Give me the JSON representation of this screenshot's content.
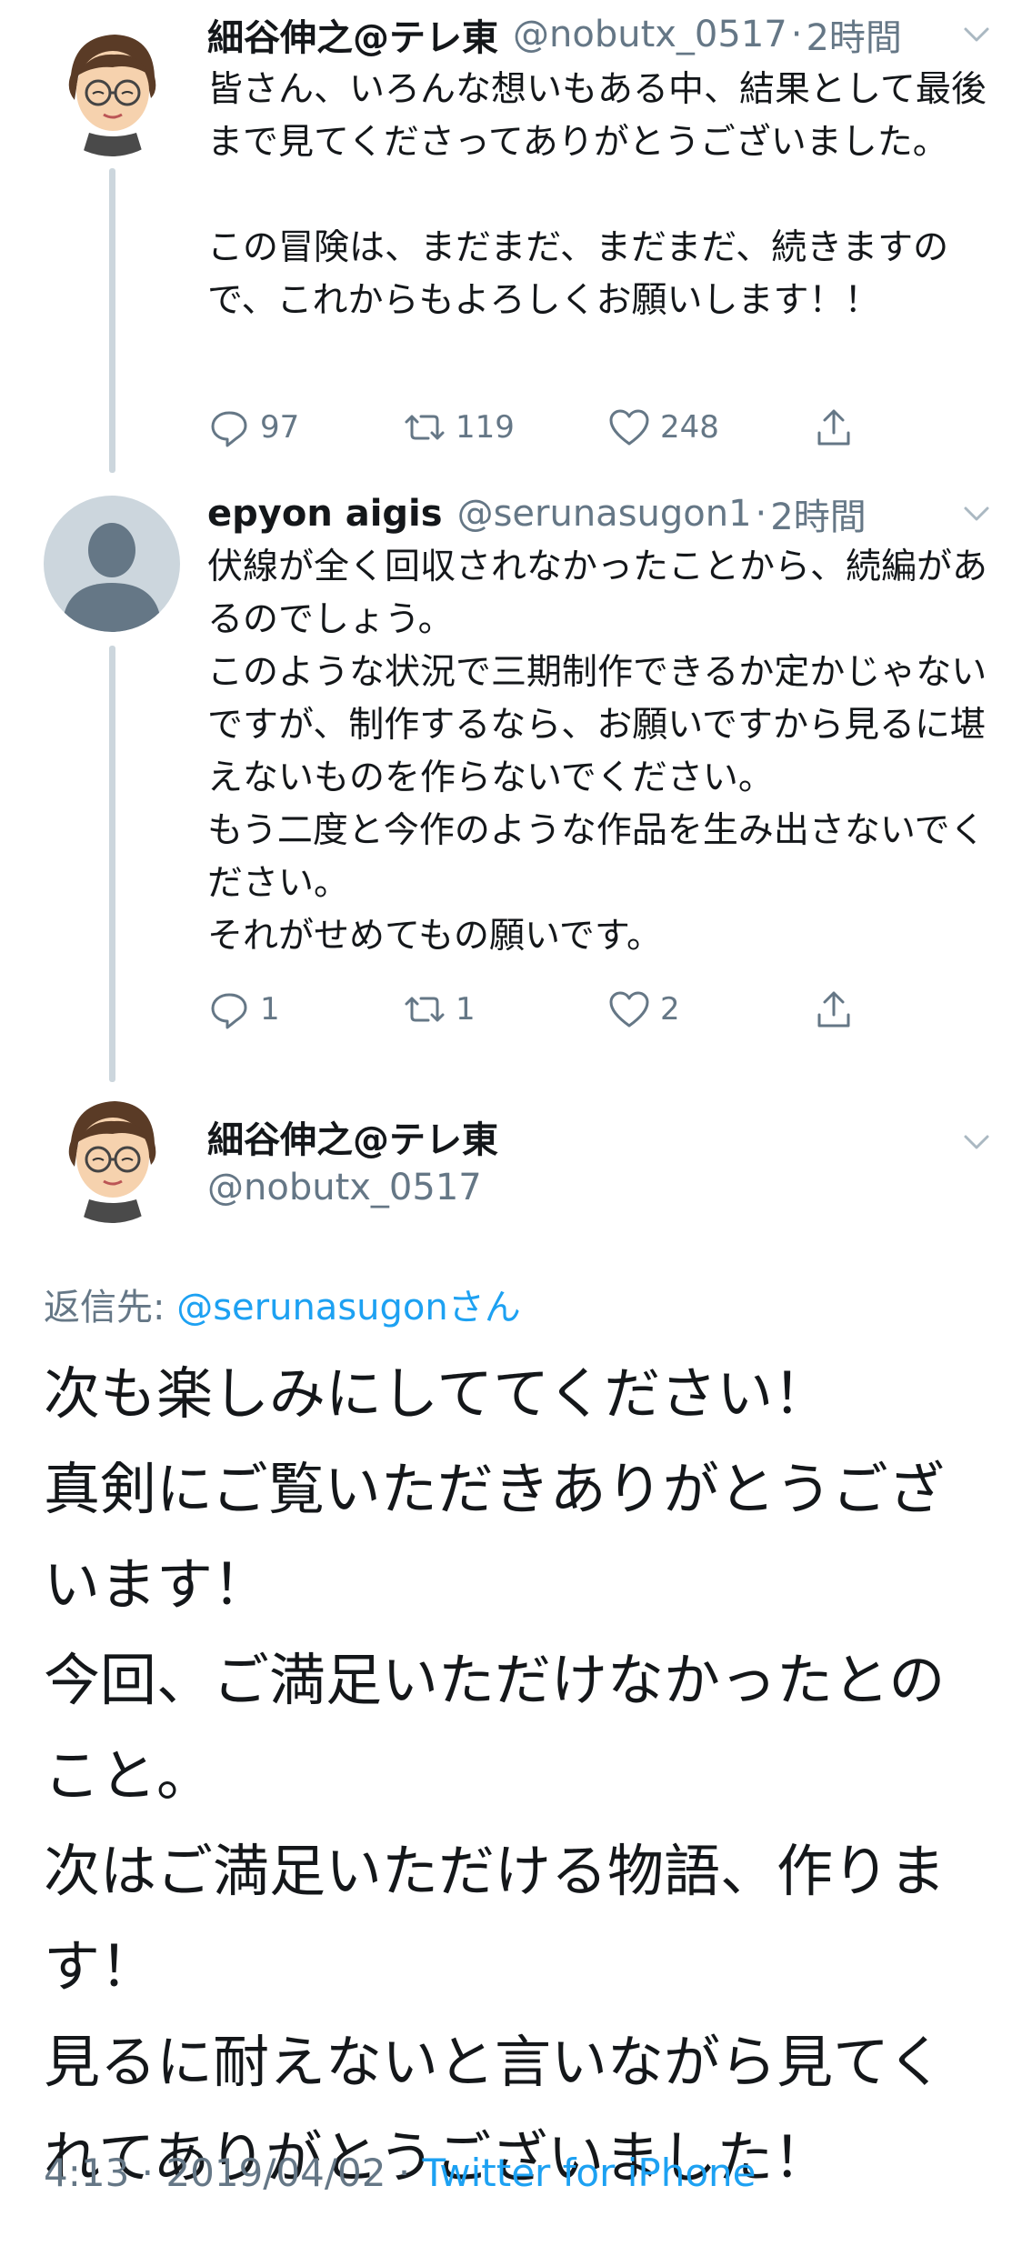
{
  "tweet1": {
    "name": "細谷伸之@テレ東",
    "handle": "@nobutx_0517",
    "dot": "·",
    "time": "2時間",
    "text": "皆さん、いろんな想いもある中、結果として最後まで見てくださってありがとうございました。\n\nこの冒険は、まだまだ、まだまだ、続きますので、これからもよろしくお願いします！！",
    "replies": "97",
    "retweets": "119",
    "likes": "248"
  },
  "tweet2": {
    "name": "epyon aigis",
    "handle": "@serunasugon1",
    "dot": "·",
    "time": "2時間",
    "text": "伏線が全く回収されなかったことから、続編があるのでしょう。\nこのような状況で三期制作できるか定かじゃないですが、制作するなら、お願いですから見るに堪えないものを作らないでください。\nもう二度と今作のような作品を生み出さないでください。\nそれがせめてもの願いです。",
    "replies": "1",
    "retweets": "1",
    "likes": "2"
  },
  "main_tweet": {
    "name": "細谷伸之@テレ東",
    "handle": "@nobutx_0517",
    "reply_prefix": "返信先: ",
    "reply_mention": "@serunasugonさん",
    "text": "次も楽しみにしててください！\n真剣にご覧いただきありがとうございます！\n今回、ご満足いただけなかったとのこと。\n次はご満足いただける物語、作ります！\n見るに耐えないと言いながら見てくれてありがとうございました！",
    "time": "4:13",
    "sep1": " · ",
    "date": "2019/04/02",
    "sep2": " · ",
    "source": "Twitter for iPhone"
  },
  "colors": {
    "accent": "#1da1f2",
    "secondary_text": "#657786",
    "thread_line": "#ccd6dd"
  },
  "icons": [
    "reply-icon",
    "retweet-icon",
    "like-icon",
    "share-icon",
    "chevron-down-icon",
    "avatar-illustration",
    "default-avatar-icon"
  ]
}
